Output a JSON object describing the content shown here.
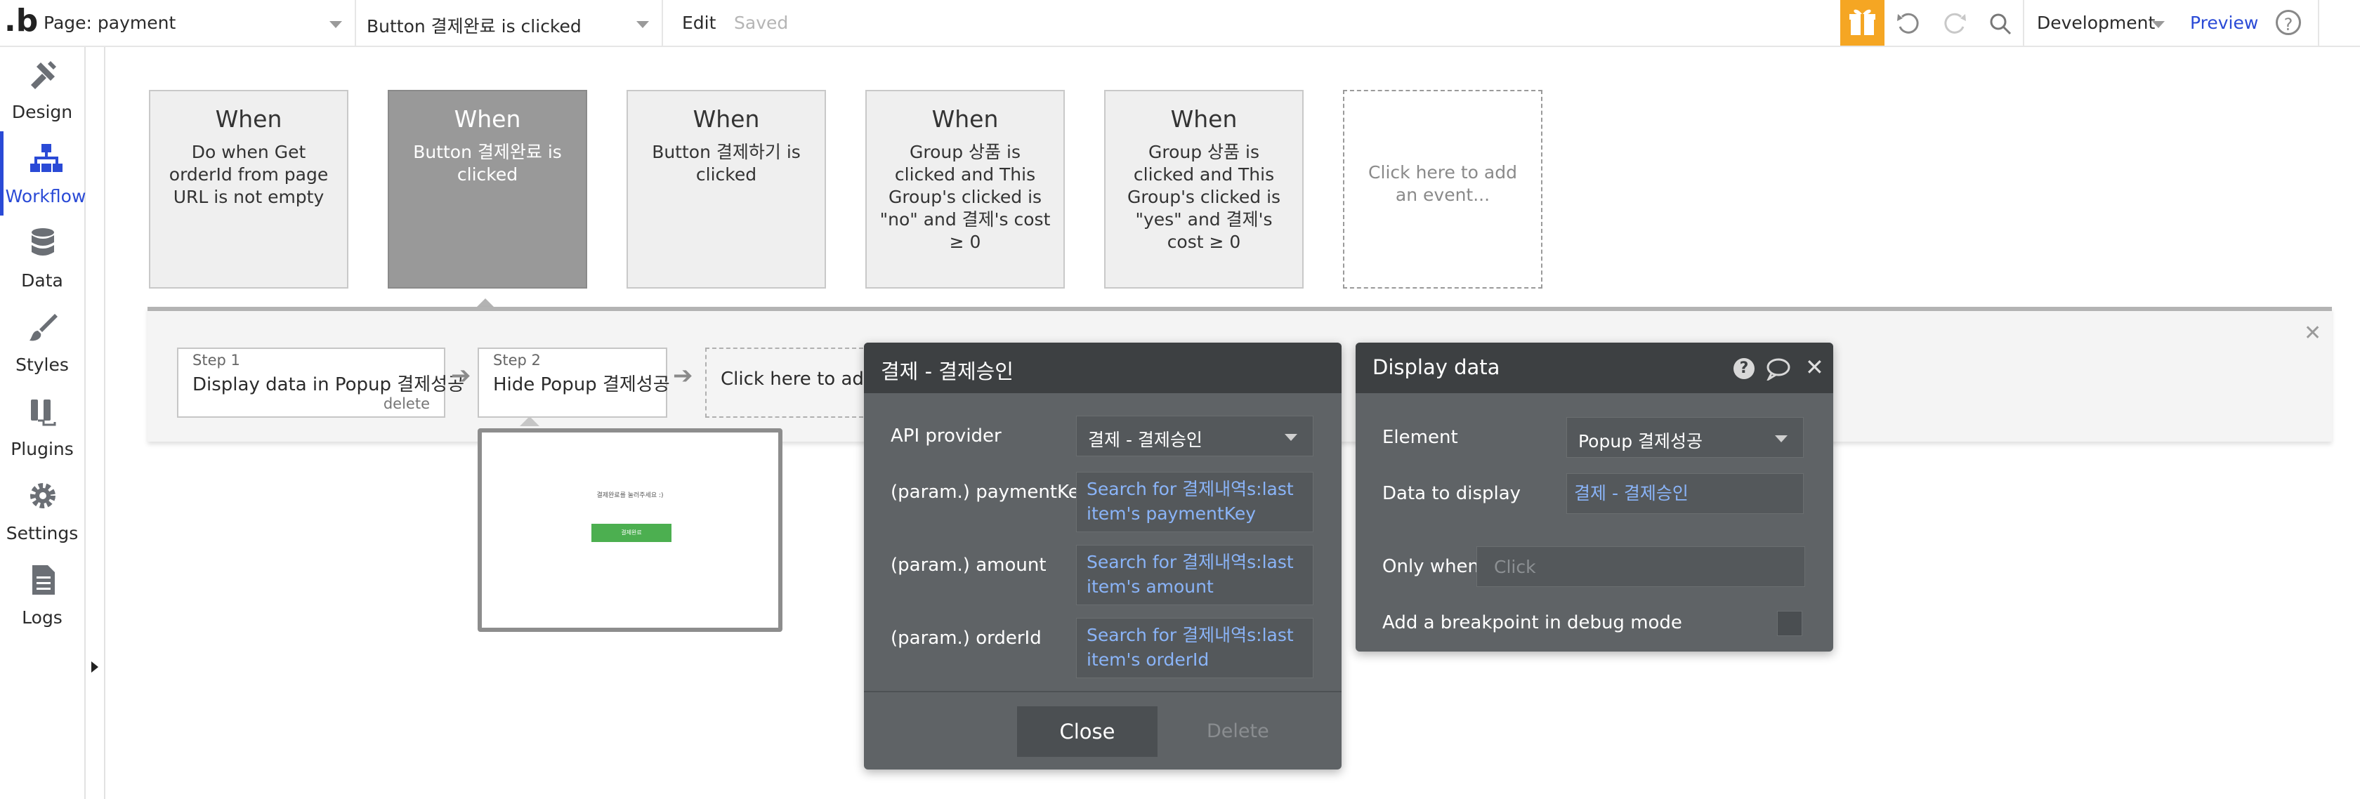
{
  "topbar": {
    "logo": ".b",
    "page_select": "Page: payment",
    "event_select": "Button 결제완료 is clicked",
    "edit_label": "Edit",
    "saved_label": "Saved",
    "env_select": "Development",
    "preview_label": "Preview",
    "help_symbol": "?",
    "gift_color": "#f5a623"
  },
  "sidebar": {
    "items": [
      {
        "label": "Design",
        "icon": "design-icon"
      },
      {
        "label": "Workflow",
        "icon": "workflow-icon"
      },
      {
        "label": "Data",
        "icon": "data-icon"
      },
      {
        "label": "Styles",
        "icon": "styles-icon"
      },
      {
        "label": "Plugins",
        "icon": "plugins-icon"
      },
      {
        "label": "Settings",
        "icon": "settings-icon"
      },
      {
        "label": "Logs",
        "icon": "logs-icon"
      }
    ],
    "active": "Workflow",
    "accent": "#2a4ad6"
  },
  "events": [
    {
      "when": "When",
      "desc": "Do when Get orderId from page URL is not empty"
    },
    {
      "when": "When",
      "desc": "Button 결제완료 is clicked"
    },
    {
      "when": "When",
      "desc": "Button 결제하기 is clicked"
    },
    {
      "when": "When",
      "desc": "Group 상품 is clicked and This Group's clicked is \"no\" and 결제's cost ≥ 0"
    },
    {
      "when": "When",
      "desc": "Group 상품 is clicked and This Group's clicked is \"yes\" and 결제's cost ≥ 0"
    },
    {
      "when": "",
      "desc": "Click here to add an event..."
    }
  ],
  "steps": [
    {
      "number": "Step 1",
      "title": "Display data in Popup 결제성공",
      "delete": "delete"
    },
    {
      "number": "Step 2",
      "title": "Hide Popup 결제성공"
    },
    {
      "number": "",
      "title": "Click here to add a"
    }
  ],
  "step_close_symbol": "✕",
  "preview_popup": {
    "text": "결제완료를 눌러주세요 :)",
    "button": "결제완료",
    "button_color": "#4caf50"
  },
  "api_panel": {
    "title": "결제 - 결제승인",
    "rows": [
      {
        "label": "API provider",
        "value": "결제 - 결제승인"
      },
      {
        "label": "(param.) paymentKey",
        "value": "Search for 결제내역s:last item's paymentKey"
      },
      {
        "label": "(param.) amount",
        "value": "Search for 결제내역s:last item's amount"
      },
      {
        "label": "(param.) orderId",
        "value": "Search for 결제내역s:last item's orderId"
      }
    ],
    "close_label": "Close",
    "delete_label": "Delete"
  },
  "display_panel": {
    "title": "Display data",
    "help_symbol": "?",
    "close_symbol": "✕",
    "element_label": "Element",
    "element_value": "Popup 결제성공",
    "data_label": "Data to display",
    "data_value": "결제 - 결제승인",
    "only_when_label": "Only when",
    "only_when_placeholder": "Click",
    "breakpoint_label": "Add a breakpoint in debug mode"
  }
}
